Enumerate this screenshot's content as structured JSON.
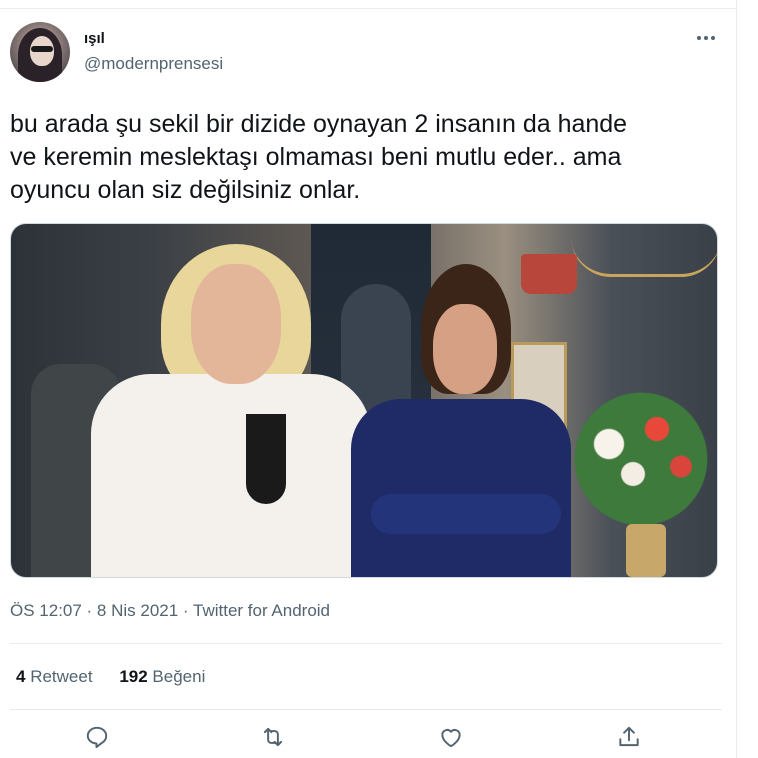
{
  "tweet": {
    "display_name": "ışıl",
    "username": "@modernprensesi",
    "text_lines": [
      "bu arada şu sekil bir dizide oynayan 2 insanın da hande",
      "ve keremin meslektaşı olmaması beni mutlu eder.. ama",
      "oyuncu olan siz değilsiniz onlar."
    ],
    "meta": "ÖS 12:07 · 8 Nis 2021 · Twitter for Android",
    "stats": {
      "retweets_count": "4",
      "retweets_label": "Retweet",
      "likes_count": "192",
      "likes_label": "Beğeni"
    }
  },
  "icons": {
    "more": "more-icon",
    "reply": "reply-icon",
    "retweet": "retweet-icon",
    "like": "heart-icon",
    "share": "share-icon"
  },
  "colors": {
    "text_primary": "#0f1419",
    "text_secondary": "#536471",
    "divider": "#e6ecf0"
  }
}
